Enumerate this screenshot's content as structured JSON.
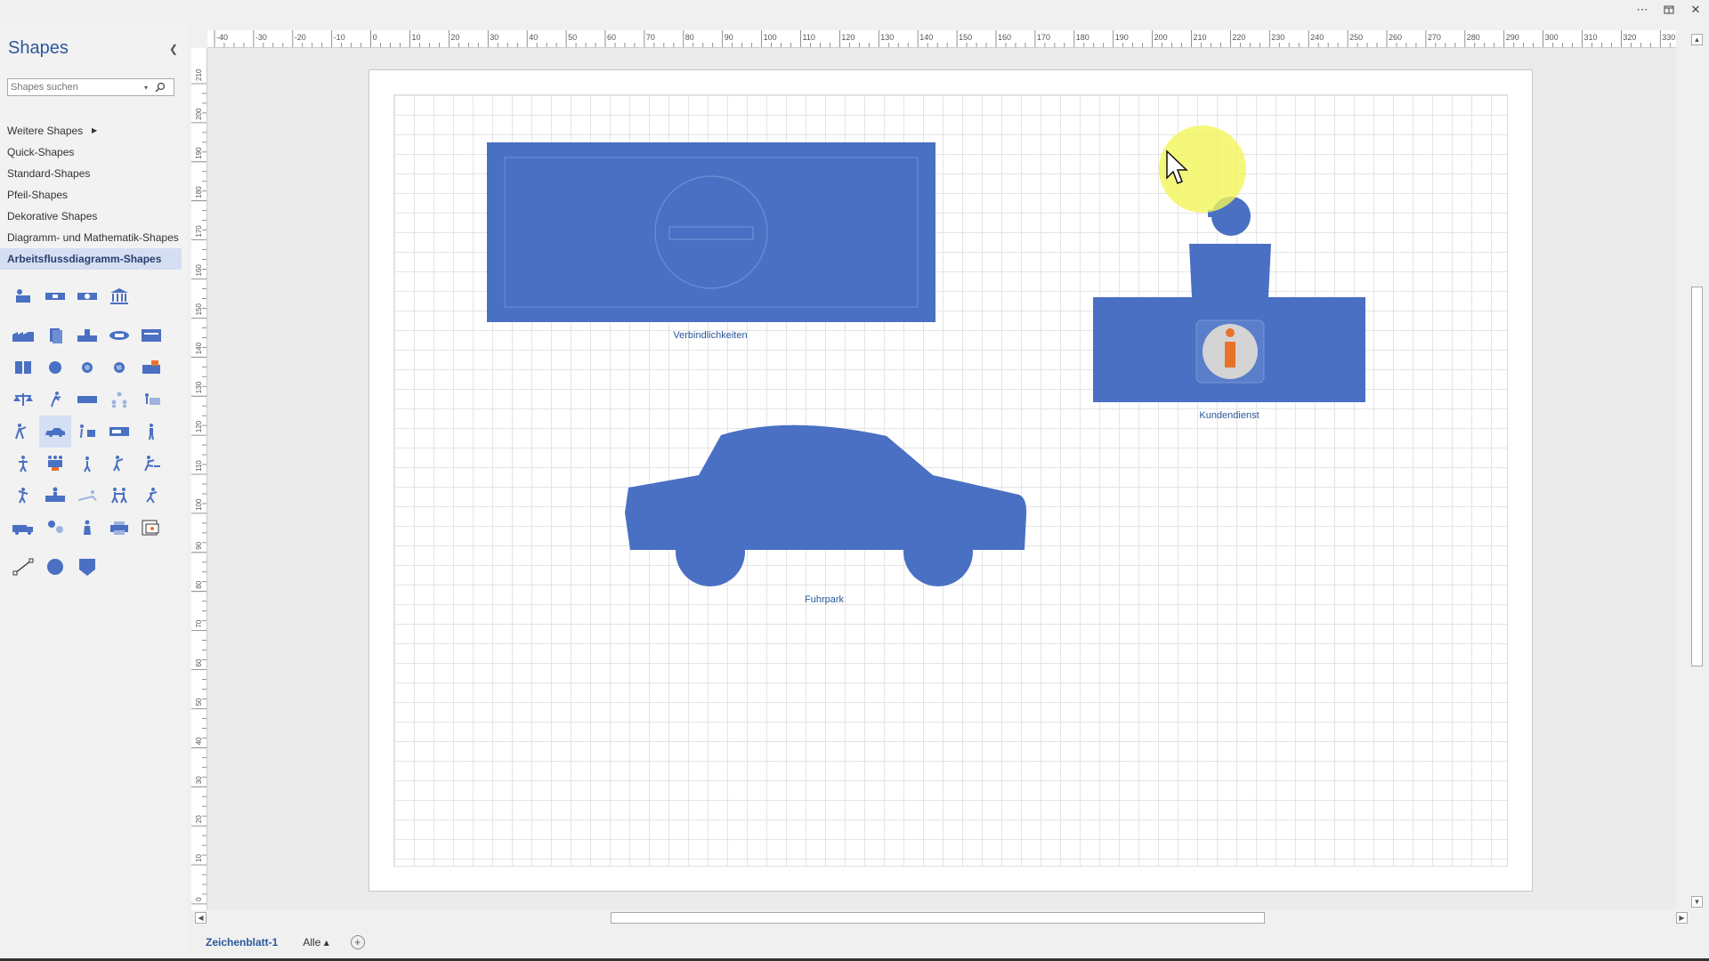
{
  "window": {
    "more_icon": "more-dots",
    "restore_icon": "restore",
    "close_icon": "close"
  },
  "sidebar": {
    "title": "Shapes",
    "search_placeholder": "Shapes suchen",
    "stencils": [
      {
        "label": "Weitere Shapes",
        "has_submenu": true
      },
      {
        "label": "Quick-Shapes"
      },
      {
        "label": "Standard-Shapes"
      },
      {
        "label": "Pfeil-Shapes"
      },
      {
        "label": "Dekorative Shapes"
      },
      {
        "label": "Diagramm- und Mathematik-Shapes"
      },
      {
        "label": "Arbeitsflussdiagramm-Shapes",
        "selected": true
      }
    ]
  },
  "ruler": {
    "h_labels": [
      "-40",
      "-30",
      "-20",
      "-10",
      "0",
      "10",
      "20",
      "30",
      "40",
      "50",
      "60",
      "70",
      "80",
      "90",
      "100",
      "110",
      "120",
      "130",
      "140",
      "150",
      "160",
      "170",
      "180",
      "190",
      "200",
      "210",
      "220",
      "230",
      "240",
      "250",
      "260",
      "270",
      "280",
      "290",
      "300",
      "310",
      "320",
      "330"
    ],
    "v_labels": [
      "210",
      "200",
      "190",
      "180",
      "170",
      "160",
      "150",
      "140",
      "130",
      "120",
      "110",
      "100",
      "90",
      "80",
      "70",
      "60",
      "50",
      "40",
      "30",
      "20",
      "10",
      "0"
    ]
  },
  "shapes": {
    "verbindlichkeiten": "Verbindlichkeiten",
    "kundendienst": "Kundendienst",
    "fuhrpark": "Fuhrpark"
  },
  "tabs": {
    "page": "Zeichenblatt-1",
    "all": "Alle ▴",
    "add": "+"
  },
  "colors": {
    "shape_blue": "#4a70c4",
    "accent": "#2b579a",
    "highlight": "#f3f55a",
    "info_orange": "#e8722a"
  }
}
